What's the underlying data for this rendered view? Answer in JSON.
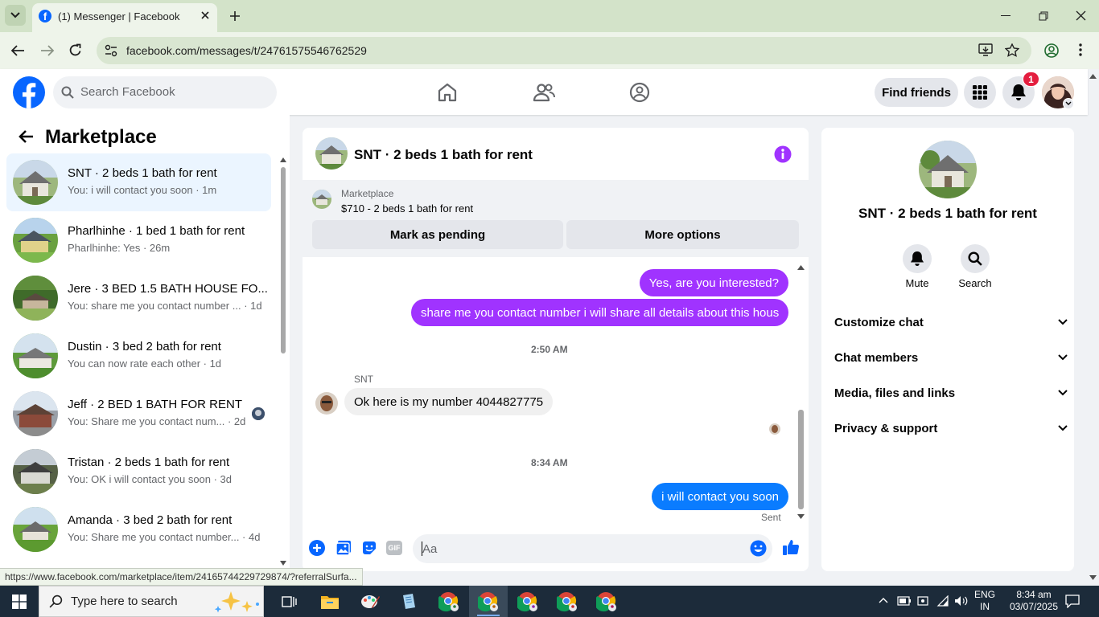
{
  "browser": {
    "tab_title": "(1) Messenger | Facebook",
    "url": "facebook.com/messages/t/24761575546762529",
    "status_url": "https://www.facebook.com/marketplace/item/24165744229729874/?referralSurfa..."
  },
  "header": {
    "search_placeholder": "Search Facebook",
    "find_friends": "Find friends",
    "notifications_count": "1"
  },
  "sidebar": {
    "title": "Marketplace",
    "conversations": [
      {
        "name": "SNT · 2 beds 1 bath for rent",
        "preview": "You: i will contact you soon · 1m"
      },
      {
        "name": "Pharlhinhe · 1 bed 1 bath for rent",
        "preview": "Pharlhinhe: Yes · 26m"
      },
      {
        "name": "Jere · 3 BED 1.5 BATH HOUSE FO...",
        "preview": "You: share me you contact number ... · 1d"
      },
      {
        "name": "Dustin · 3 bed 2 bath for rent",
        "preview": "You can now rate each other · 1d"
      },
      {
        "name": "Jeff · 2 BED 1 BATH FOR RENT",
        "preview": "You: Share me you contact num... · 2d"
      },
      {
        "name": "Tristan · 2 beds 1 bath for rent",
        "preview": "You: OK i will contact you soon · 3d"
      },
      {
        "name": "Amanda · 3 bed 2 bath for rent",
        "preview": "You: Share me you contact number... · 4d"
      }
    ]
  },
  "chat": {
    "title": "SNT · 2 beds 1 bath for rent",
    "listing_source": "Marketplace",
    "listing_price": "$710 - 2 beds 1 bath for rent",
    "mark_pending": "Mark as pending",
    "more_options": "More options",
    "messages": {
      "m1": "Yes, are you interested?",
      "m2": "share me you contact number i will share all details about this hous",
      "t1": "2:50 AM",
      "sender": "SNT",
      "m3": "Ok here is my number 4044827775",
      "t2": "8:34 AM",
      "m4": "i will contact you soon",
      "status": "Sent"
    },
    "composer_placeholder": "Aa"
  },
  "info_panel": {
    "name": "SNT · 2 beds 1 bath for rent",
    "mute": "Mute",
    "search": "Search",
    "sections": [
      "Customize chat",
      "Chat members",
      "Media, files and links",
      "Privacy & support"
    ]
  },
  "taskbar": {
    "search": "Type here to search",
    "lang_1": "ENG",
    "lang_2": "IN",
    "time": "8:34 am",
    "date": "03/07/2025"
  },
  "colors": {
    "fb_blue": "#0866ff",
    "outgoing_purple": "#a033ff",
    "outgoing_blue": "#0a7cff",
    "notif_red": "#e41e3f",
    "messenger_accent": "#a033ff"
  }
}
